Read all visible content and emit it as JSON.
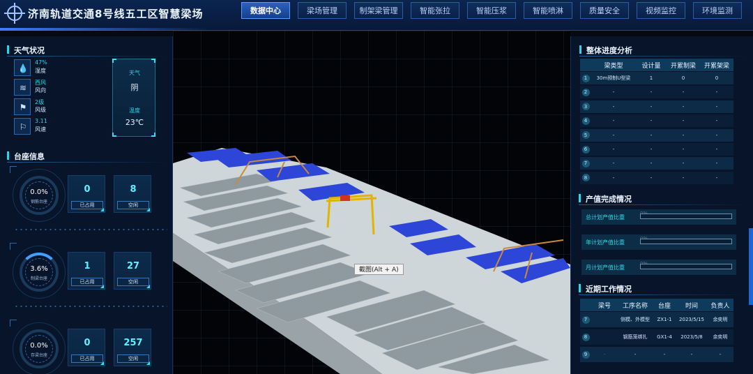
{
  "header": {
    "title": "济南轨道交通8号线五工区智慧梁场",
    "nav": [
      {
        "label": "数据中心",
        "active": true
      },
      {
        "label": "梁场管理",
        "active": false
      },
      {
        "label": "制架梁管理",
        "active": false
      },
      {
        "label": "智能张拉",
        "active": false
      },
      {
        "label": "智能压浆",
        "active": false
      },
      {
        "label": "智能喷淋",
        "active": false
      },
      {
        "label": "质量安全",
        "active": false
      },
      {
        "label": "视频监控",
        "active": false
      },
      {
        "label": "环境监测",
        "active": false
      }
    ]
  },
  "weather": {
    "title": "天气状况",
    "items": [
      {
        "icon": "humidity-icon",
        "value": "47%",
        "label": "湿度"
      },
      {
        "icon": "wind-direction-icon",
        "value": "西风",
        "label": "风向"
      },
      {
        "icon": "wind-level-icon",
        "value": "2级",
        "label": "风级"
      },
      {
        "icon": "wind-speed-icon",
        "value": "3.11",
        "label": "风速"
      }
    ],
    "card": {
      "weather_label": "天气",
      "weather_value": "阴",
      "temp_label": "温度",
      "temp_value": "23℃"
    }
  },
  "pedestal": {
    "title": "台座信息",
    "groups": [
      {
        "percent": "0.0%",
        "percent_value": 0.0,
        "gauge_label": "钢筋台座",
        "occupied": "0",
        "occupied_label": "已占用",
        "idle": "8",
        "idle_label": "空闲"
      },
      {
        "percent": "3.6%",
        "percent_value": 3.6,
        "gauge_label": "制梁台座",
        "occupied": "1",
        "occupied_label": "已占用",
        "idle": "27",
        "idle_label": "空闲"
      },
      {
        "percent": "0.0%",
        "percent_value": 0.0,
        "gauge_label": "存梁台座",
        "occupied": "0",
        "occupied_label": "已占用",
        "idle": "257",
        "idle_label": "空闲"
      }
    ]
  },
  "progress": {
    "title": "整体进度分析",
    "headers": [
      "梁类型",
      "设计量",
      "开累制梁",
      "开累架梁"
    ],
    "rows": [
      {
        "idx": "1",
        "type": "30m预制U型梁",
        "design": "1",
        "made": "0",
        "erected": "0"
      },
      {
        "idx": "2",
        "type": "-",
        "design": "-",
        "made": "-",
        "erected": "-"
      },
      {
        "idx": "3",
        "type": "-",
        "design": "-",
        "made": "-",
        "erected": "-"
      },
      {
        "idx": "4",
        "type": "-",
        "design": "-",
        "made": "-",
        "erected": "-"
      },
      {
        "idx": "5",
        "type": "-",
        "design": "-",
        "made": "-",
        "erected": "-"
      },
      {
        "idx": "6",
        "type": "-",
        "design": "-",
        "made": "-",
        "erected": "-"
      },
      {
        "idx": "7",
        "type": "-",
        "design": "-",
        "made": "-",
        "erected": "-"
      },
      {
        "idx": "8",
        "type": "-",
        "design": "-",
        "made": "-",
        "erected": "-"
      }
    ]
  },
  "output": {
    "title": "产值完成情况",
    "items": [
      {
        "label": "总计划产值比重",
        "percent": "0%",
        "value": 0
      },
      {
        "label": "年计划产值比重",
        "percent": "0%",
        "value": 0
      },
      {
        "label": "月计划产值比重",
        "percent": "0%",
        "value": 0
      }
    ]
  },
  "recent": {
    "title": "近期工作情况",
    "headers": [
      "梁号",
      "工序名称",
      "台座",
      "时间",
      "负责人"
    ],
    "rows": [
      {
        "idx": "7",
        "beam": "",
        "step": "侧模、外模型",
        "seat": "ZX1-1",
        "time": "2023/5/15",
        "owner": "余奕明"
      },
      {
        "idx": "8",
        "beam": "",
        "step": "钢筋笼绑扎",
        "seat": "GX1-4",
        "time": "2023/5/8",
        "owner": "余奕明"
      },
      {
        "idx": "9",
        "beam": "-",
        "step": "-",
        "seat": "-",
        "time": "-",
        "owner": "-"
      }
    ]
  },
  "scene": {
    "tooltip": "截图(Alt + A)"
  },
  "colors": {
    "accent": "#28d7e8",
    "nav_active": "#2a61c2",
    "panel_bg": "#08162d"
  }
}
